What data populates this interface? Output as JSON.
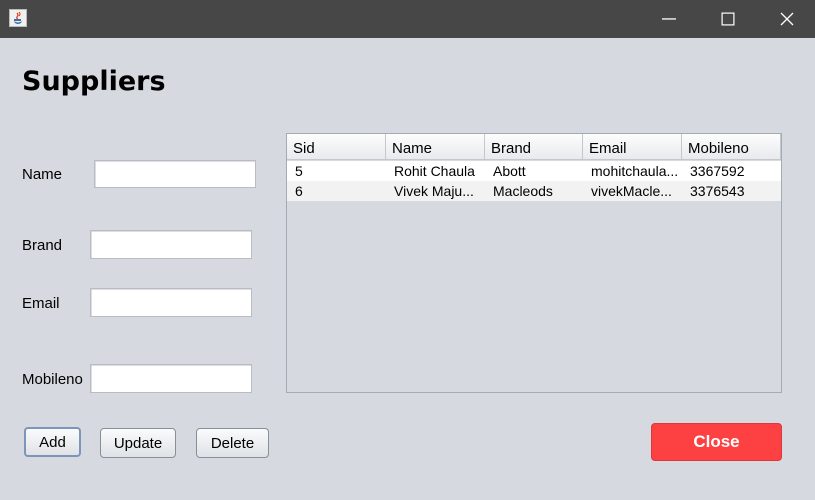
{
  "window": {
    "minimize_icon": "minimize-icon",
    "maximize_icon": "maximize-icon",
    "close_icon": "close-icon"
  },
  "form": {
    "heading": "Suppliers",
    "name_label": "Name",
    "brand_label": "Brand",
    "email_label": "Email",
    "mobileno_label": "Mobileno",
    "name_value": "",
    "brand_value": "",
    "email_value": "",
    "mobileno_value": ""
  },
  "table": {
    "columns": [
      "Sid",
      "Name",
      "Brand",
      "Email",
      "Mobileno"
    ],
    "rows": [
      [
        "5",
        "Rohit Chaula",
        "Abott",
        "mohitchaula...",
        "3367592"
      ],
      [
        "6",
        "Vivek Maju...",
        "Macleods",
        "vivekMacle...",
        "3376543"
      ]
    ]
  },
  "buttons": {
    "add": "Add",
    "update": "Update",
    "delete": "Delete",
    "close": "Close"
  },
  "colors": {
    "close_button": "#fd4142",
    "titlebar": "#474747",
    "background": "#d6d9df"
  }
}
